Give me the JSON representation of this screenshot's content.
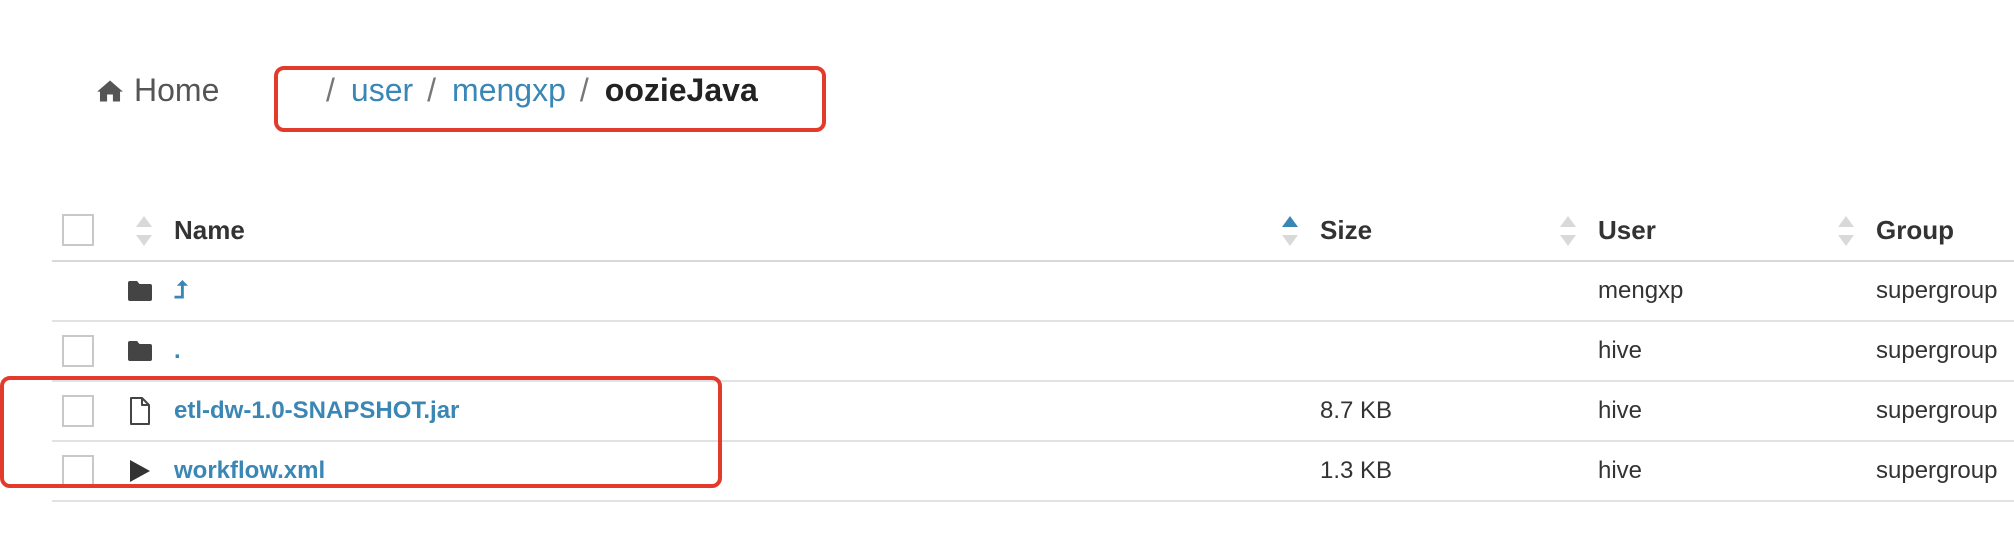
{
  "breadcrumb": {
    "home_label": "Home",
    "separator": "/",
    "segments": [
      "user",
      "mengxp"
    ],
    "current": "oozieJava"
  },
  "table": {
    "columns": {
      "name": "Name",
      "size": "Size",
      "user": "User",
      "group": "Group"
    },
    "rows": [
      {
        "icon": "folder-icon",
        "name": "⮥",
        "size": "",
        "user": "mengxp",
        "group": "supergroup"
      },
      {
        "icon": "folder-icon",
        "name": ".",
        "size": "",
        "user": "hive",
        "group": "supergroup"
      },
      {
        "icon": "file-icon",
        "name": "etl-dw-1.0-SNAPSHOT.jar",
        "size": "8.7 KB",
        "user": "hive",
        "group": "supergroup"
      },
      {
        "icon": "play-icon",
        "name": "workflow.xml",
        "size": "1.3 KB",
        "user": "hive",
        "group": "supergroup"
      }
    ]
  },
  "colors": {
    "link": "#3a87b6",
    "highlight": "#e33b2b"
  }
}
